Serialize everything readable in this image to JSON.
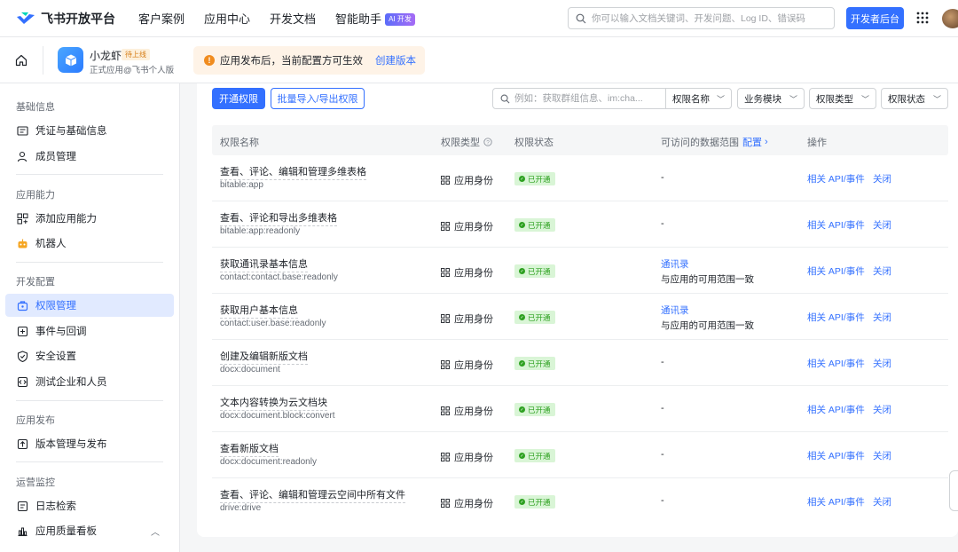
{
  "header": {
    "brand": "飞书开放平台",
    "nav": [
      "客户案例",
      "应用中心",
      "开发文档",
      "智能助手"
    ],
    "ai_badge": "AI 开发",
    "search_placeholder": "你可以输入文档关键词、开发问题、Log ID、错误码",
    "dev_console": "开发者后台"
  },
  "app": {
    "name": "小龙虾",
    "status": "待上线",
    "subtitle": "正式应用@飞书个人版",
    "notice": "应用发布后，当前配置方可生效",
    "notice_link": "创建版本"
  },
  "sidebar": {
    "sections": [
      {
        "title": "基础信息",
        "items": [
          "凭证与基础信息",
          "成员管理"
        ]
      },
      {
        "title": "应用能力",
        "items": [
          "添加应用能力",
          "机器人"
        ]
      },
      {
        "title": "开发配置",
        "items": [
          "权限管理",
          "事件与回调",
          "安全设置",
          "测试企业和人员"
        ]
      },
      {
        "title": "应用发布",
        "items": [
          "版本管理与发布"
        ]
      },
      {
        "title": "运营监控",
        "items": [
          "日志检索",
          "应用质量看板"
        ]
      }
    ],
    "active": "权限管理"
  },
  "toolbar": {
    "enable_button": "开通权限",
    "bulk_button": "批量导入/导出权限",
    "search_placeholder": "例如：获取群组信息、im:cha...",
    "search_field": "权限名称",
    "filters": [
      "业务模块",
      "权限类型",
      "权限状态"
    ]
  },
  "table": {
    "headers": {
      "name": "权限名称",
      "type": "权限类型",
      "status": "权限状态",
      "scope": "可访问的数据范围",
      "scope_link": "配置",
      "ops": "操作"
    },
    "rows": [
      {
        "name": "查看、评论、编辑和管理多维表格",
        "code": "bitable:app",
        "type": "应用身份",
        "status": "已开通",
        "scope": "-",
        "scope_link": "",
        "api": "相关 API/事件",
        "close": "关闭"
      },
      {
        "name": "查看、评论和导出多维表格",
        "code": "bitable:app:readonly",
        "type": "应用身份",
        "status": "已开通",
        "scope": "-",
        "scope_link": "",
        "api": "相关 API/事件",
        "close": "关闭"
      },
      {
        "name": "获取通讯录基本信息",
        "code": "contact:contact.base:readonly",
        "type": "应用身份",
        "status": "已开通",
        "scope": "与应用的可用范围一致",
        "scope_link": "通讯录",
        "api": "相关 API/事件",
        "close": "关闭"
      },
      {
        "name": "获取用户基本信息",
        "code": "contact:user.base:readonly",
        "type": "应用身份",
        "status": "已开通",
        "scope": "与应用的可用范围一致",
        "scope_link": "通讯录",
        "api": "相关 API/事件",
        "close": "关闭"
      },
      {
        "name": "创建及编辑新版文档",
        "code": "docx:document",
        "type": "应用身份",
        "status": "已开通",
        "scope": "-",
        "scope_link": "",
        "api": "相关 API/事件",
        "close": "关闭"
      },
      {
        "name": "文本内容转换为云文档块",
        "code": "docx:document.block:convert",
        "type": "应用身份",
        "status": "已开通",
        "scope": "-",
        "scope_link": "",
        "api": "相关 API/事件",
        "close": "关闭"
      },
      {
        "name": "查看新版文档",
        "code": "docx:document:readonly",
        "type": "应用身份",
        "status": "已开通",
        "scope": "-",
        "scope_link": "",
        "api": "相关 API/事件",
        "close": "关闭"
      },
      {
        "name": "查看、评论、编辑和管理云空间中所有文件",
        "code": "drive:drive",
        "type": "应用身份",
        "status": "已开通",
        "scope": "-",
        "scope_link": "",
        "api": "相关 API/事件",
        "close": "关闭"
      }
    ]
  },
  "colors": {
    "accent": "#3370ff",
    "success": "#2ea121",
    "warning": "#f08c1f"
  }
}
